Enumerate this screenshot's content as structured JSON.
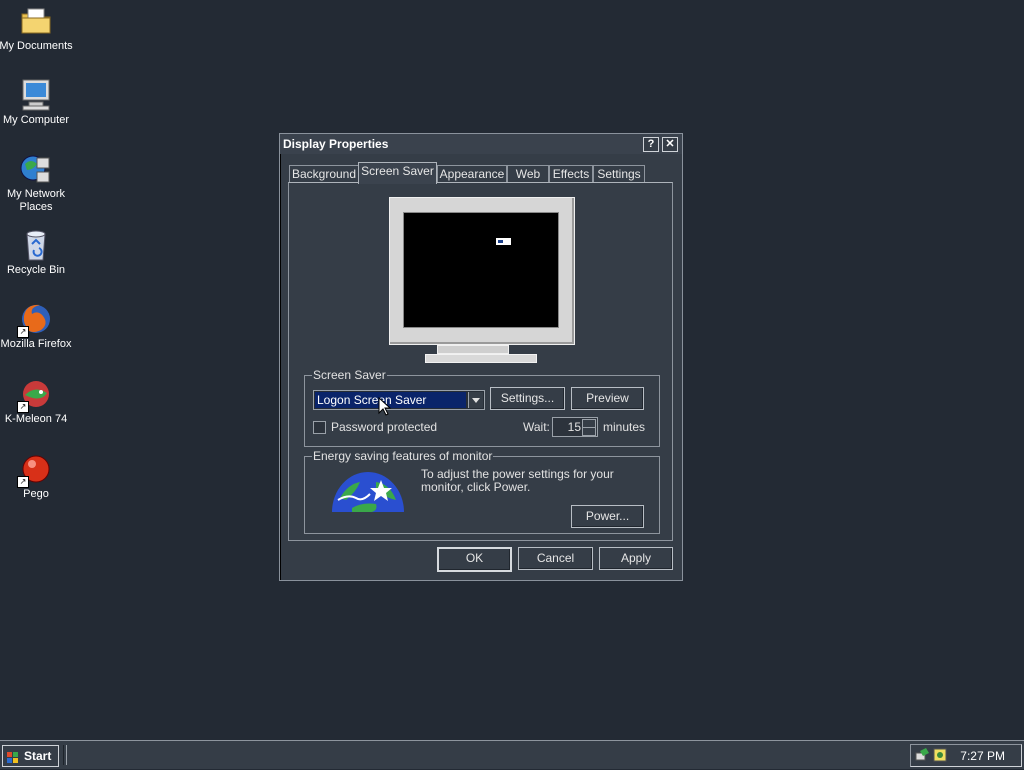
{
  "desktop": {
    "icons": [
      {
        "label": "My Documents",
        "icon": "folder-documents-icon"
      },
      {
        "label": "My Computer",
        "icon": "computer-icon"
      },
      {
        "label": "My Network Places",
        "icon": "network-places-icon"
      },
      {
        "label": "Recycle Bin",
        "icon": "recycle-bin-icon"
      },
      {
        "label": "Mozilla Firefox",
        "icon": "firefox-icon"
      },
      {
        "label": "K-Meleon 74",
        "icon": "kmeleon-icon"
      },
      {
        "label": "Pego",
        "icon": "pego-icon"
      }
    ]
  },
  "dialog": {
    "title": "Display Properties",
    "help_glyph": "?",
    "close_glyph": "✕",
    "tabs": [
      "Background",
      "Screen Saver",
      "Appearance",
      "Web",
      "Effects",
      "Settings"
    ],
    "active_tab": "Screen Saver",
    "screensaver": {
      "group_label": "Screen Saver",
      "selected": "Logon Screen Saver",
      "settings_button": "Settings...",
      "preview_button": "Preview",
      "password_label": "Password protected",
      "password_checked": false,
      "wait_label": "Wait:",
      "wait_value": "15",
      "minutes_label": "minutes"
    },
    "energy": {
      "group_label": "Energy saving features of monitor",
      "description": "To adjust the power settings for your monitor, click Power.",
      "power_button": "Power..."
    },
    "buttons": {
      "ok": "OK",
      "cancel": "Cancel",
      "apply": "Apply"
    }
  },
  "taskbar": {
    "start_label": "Start",
    "clock": "7:27 PM"
  },
  "colors": {
    "desktop": "#232a34",
    "dialog": "#353d47",
    "selection": "#0a246a"
  }
}
